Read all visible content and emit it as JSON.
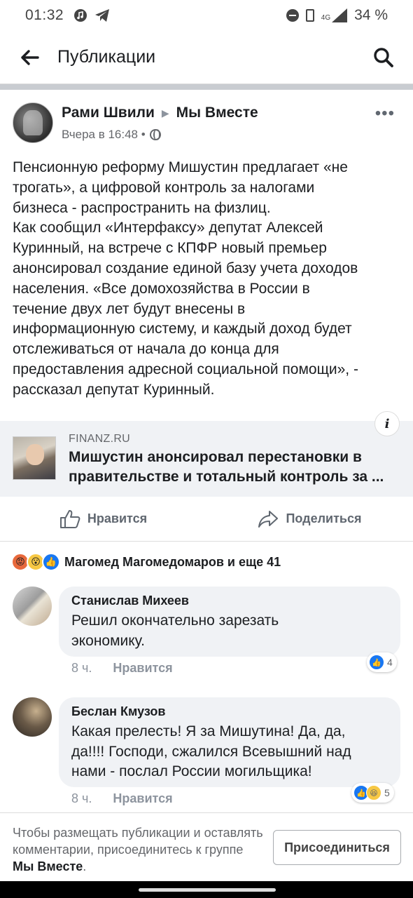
{
  "status_bar": {
    "time": "01:32",
    "battery": "34 %",
    "network": "4G"
  },
  "appbar": {
    "title": "Публикации"
  },
  "post": {
    "author": "Рами Швили",
    "group": "Мы Вместе",
    "timestamp": "Вчера в 16:48 •",
    "text_lines": [
      "Пенсионную реформу Мишустин предлагает «не",
      "трогать», а цифровой контроль за налогами",
      "бизнеса - распространить на физлиц.",
      "Как сообщил «Интерфаксу» депутат Алексей",
      "Куринный, на встрече с КПФР новый премьер",
      "анонсировал создание единой базу учета доходов",
      "населения. «Все домохозяйства в России в",
      "течение двух лет будут внесены в",
      "информационную систему, и каждый доход будет",
      "отслеживаться от начала до конца для",
      "предоставления адресной социальной помощи», -",
      "рассказал депутат Куринный."
    ],
    "link": {
      "domain": "FINANZ.RU",
      "title": "Мишустин анонсировал перестановки в правительстве и тотальный контроль за ..."
    },
    "like_label": "Нравится",
    "share_label": "Поделиться",
    "reactions_summary": "Магомед Магомедомаров и еще 41"
  },
  "comments": [
    {
      "author": "Станислав Михеев",
      "lines": [
        "Решил окончательно зарезать",
        "экономику."
      ],
      "time": "8 ч.",
      "like_label": "Нравится",
      "reaction_count": "4"
    },
    {
      "author": "Беслан Кмузов",
      "lines": [
        "Какая прелесть! Я за Мишутина! Да, да,",
        "да!!!! Господи, сжалился Всевышний над",
        "нами - послал России могильщика!"
      ],
      "time": "8 ч.",
      "like_label": "Нравится",
      "reaction_count": "5"
    }
  ],
  "join_bar": {
    "text": "Чтобы размещать публикации и оставлять комментарии, присоединитесь к группе",
    "group": "Мы Вместе",
    "button": "Присоединиться"
  },
  "colors": {
    "accent": "#1877f2",
    "bubble": "#f0f2f5",
    "secondary_text": "#65676b"
  }
}
